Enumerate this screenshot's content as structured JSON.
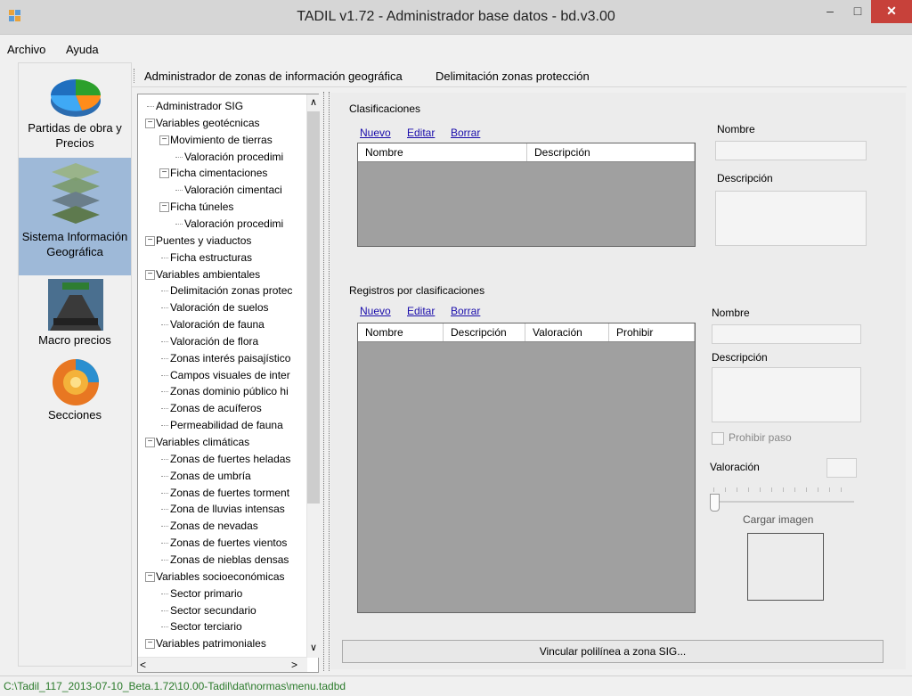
{
  "window": {
    "title": "TADIL v1.72 - Administrador base datos - bd.v3.00",
    "minimize": "–",
    "maximize": "□",
    "close": "✕"
  },
  "menu": {
    "items": [
      "Archivo",
      "Ayuda"
    ]
  },
  "sidebar": {
    "items": [
      {
        "label": "Partidas de obra y Precios",
        "icon": "pie-chart-icon"
      },
      {
        "label": "Sistema Información Geográfica",
        "icon": "gis-layers-icon",
        "selected": true
      },
      {
        "label": "Macro precios",
        "icon": "road-icon"
      },
      {
        "label": "Secciones",
        "icon": "earth-section-icon"
      }
    ]
  },
  "toolbar": {
    "items": [
      "Administrador de zonas de información geográfica",
      "Delimitación zonas protección"
    ]
  },
  "tree": {
    "nodes": [
      {
        "label": "Administrador SIG",
        "level": 0,
        "toggle": ""
      },
      {
        "label": "Variables geotécnicas",
        "level": 0,
        "toggle": "−"
      },
      {
        "label": "Movimiento de tierras",
        "level": 1,
        "toggle": "−"
      },
      {
        "label": "Valoración procedimi",
        "level": 2,
        "toggle": ""
      },
      {
        "label": "Ficha cimentaciones",
        "level": 1,
        "toggle": "−"
      },
      {
        "label": "Valoración cimentaci",
        "level": 2,
        "toggle": ""
      },
      {
        "label": "Ficha túneles",
        "level": 1,
        "toggle": "−"
      },
      {
        "label": "Valoración procedimi",
        "level": 2,
        "toggle": ""
      },
      {
        "label": "Puentes y viaductos",
        "level": 0,
        "toggle": "−"
      },
      {
        "label": "Ficha estructuras",
        "level": 1,
        "toggle": ""
      },
      {
        "label": "Variables ambientales",
        "level": 0,
        "toggle": "−"
      },
      {
        "label": "Delimitación zonas protec",
        "level": 1,
        "toggle": ""
      },
      {
        "label": "Valoración de suelos",
        "level": 1,
        "toggle": ""
      },
      {
        "label": "Valoración de fauna",
        "level": 1,
        "toggle": ""
      },
      {
        "label": "Valoración de flora",
        "level": 1,
        "toggle": ""
      },
      {
        "label": "Zonas interés paisajístico",
        "level": 1,
        "toggle": ""
      },
      {
        "label": "Campos visuales de inter",
        "level": 1,
        "toggle": ""
      },
      {
        "label": "Zonas dominio público hi",
        "level": 1,
        "toggle": ""
      },
      {
        "label": "Zonas de acuíferos",
        "level": 1,
        "toggle": ""
      },
      {
        "label": "Permeabilidad de fauna",
        "level": 1,
        "toggle": ""
      },
      {
        "label": "Variables climáticas",
        "level": 0,
        "toggle": "−"
      },
      {
        "label": "Zonas de fuertes heladas",
        "level": 1,
        "toggle": ""
      },
      {
        "label": "Zonas de umbría",
        "level": 1,
        "toggle": ""
      },
      {
        "label": "Zonas de fuertes torment",
        "level": 1,
        "toggle": ""
      },
      {
        "label": "Zona de lluvias intensas",
        "level": 1,
        "toggle": ""
      },
      {
        "label": "Zonas de nevadas",
        "level": 1,
        "toggle": ""
      },
      {
        "label": "Zonas de fuertes vientos",
        "level": 1,
        "toggle": ""
      },
      {
        "label": "Zonas de nieblas densas",
        "level": 1,
        "toggle": ""
      },
      {
        "label": "Variables socioeconómicas",
        "level": 0,
        "toggle": "−"
      },
      {
        "label": "Sector primario",
        "level": 1,
        "toggle": ""
      },
      {
        "label": "Sector secundario",
        "level": 1,
        "toggle": ""
      },
      {
        "label": "Sector terciario",
        "level": 1,
        "toggle": ""
      },
      {
        "label": "Variables patrimoniales",
        "level": 0,
        "toggle": "−"
      }
    ],
    "scroll_up": "∧",
    "scroll_down": "∨",
    "scroll_left": "<",
    "scroll_right": ">"
  },
  "clasificaciones": {
    "title": "Clasificaciones",
    "actions": [
      "Nuevo",
      "Editar",
      "Borrar"
    ],
    "columns": [
      "Nombre",
      "Descripción"
    ],
    "rows": [],
    "nombre_label": "Nombre",
    "nombre_value": "",
    "descripcion_label": "Descripción",
    "descripcion_value": ""
  },
  "registros": {
    "title": "Registros por clasificaciones",
    "actions": [
      "Nuevo",
      "Editar",
      "Borrar"
    ],
    "columns": [
      "Nombre",
      "Descripción",
      "Valoración",
      "Prohibir"
    ],
    "rows": [],
    "nombre_label": "Nombre",
    "nombre_value": "",
    "descripcion_label": "Descripción",
    "descripcion_value": "",
    "prohibir_label": "Prohibir paso",
    "prohibir_checked": false,
    "valoracion_label": "Valoración",
    "valoracion_value": "",
    "cargar_imagen_label": "Cargar imagen"
  },
  "vincular_button": "Vincular polilínea a zona SIG...",
  "status": {
    "path": "C:\\Tadil_117_2013-07-10_Beta.1.72\\10.00-Tadil\\dat\\normas\\menu.tadbd"
  }
}
